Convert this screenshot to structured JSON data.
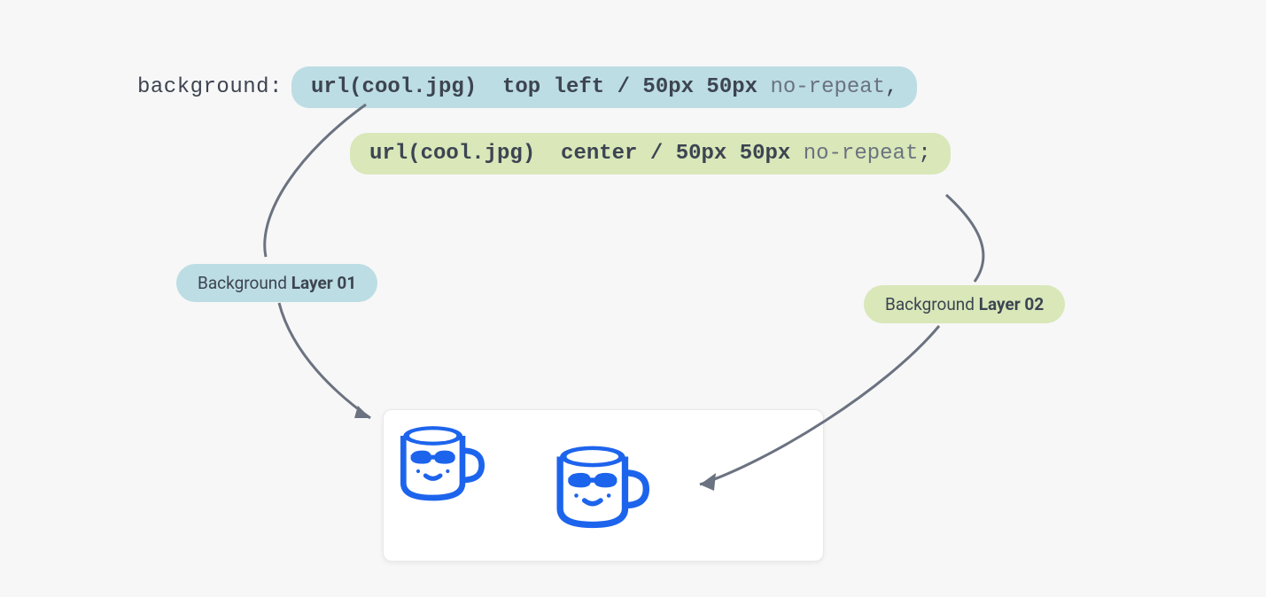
{
  "code": {
    "property": "background:",
    "layer1": {
      "url": "url(cool.jpg)",
      "pos": "top left",
      "sep": " / ",
      "size": "50px 50px",
      "repeat": "no-repeat",
      "tail": ","
    },
    "layer2": {
      "url": "url(cool.jpg)",
      "pos": "center",
      "sep": " / ",
      "size": "50px 50px",
      "repeat": "no-repeat",
      "tail": ";"
    }
  },
  "labels": {
    "prefix": "Background ",
    "layer1": "Layer 01",
    "layer2": "Layer 02"
  },
  "icons": {
    "mug": "cool-mug-icon"
  },
  "colors": {
    "blue_bg": "#bcdde3",
    "green_bg": "#d9e7b9",
    "text": "#3d4451",
    "arrow": "#6b7280",
    "mug": "#1d64ed"
  }
}
